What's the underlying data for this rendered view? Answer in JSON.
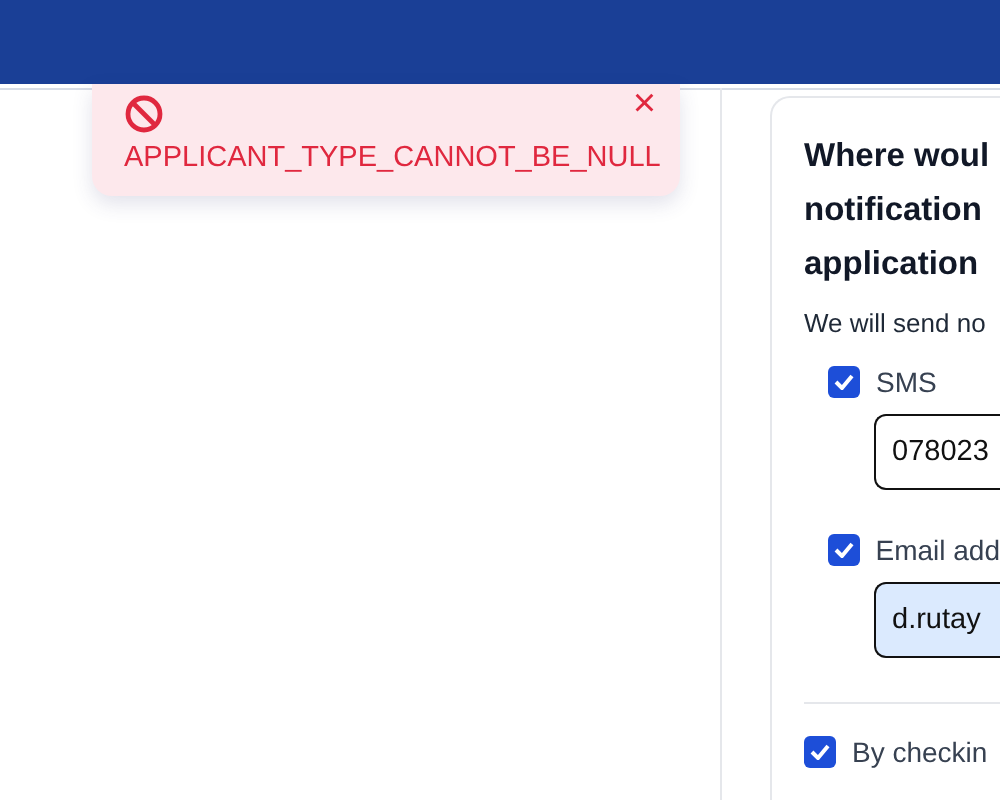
{
  "toast": {
    "message": "APPLICANT_TYPE_CANNOT_BE_NULL",
    "close": "×"
  },
  "card": {
    "heading": [
      "Where woul",
      "notification",
      "application"
    ],
    "subtitle": "We will send no",
    "channels": [
      {
        "label": "SMS",
        "checked": true,
        "value": "078023",
        "highlighted": false
      },
      {
        "label": "Email add",
        "checked": true,
        "value": "d.rutay",
        "highlighted": true
      }
    ],
    "consent": {
      "label": "By checkin",
      "checked": true
    }
  }
}
